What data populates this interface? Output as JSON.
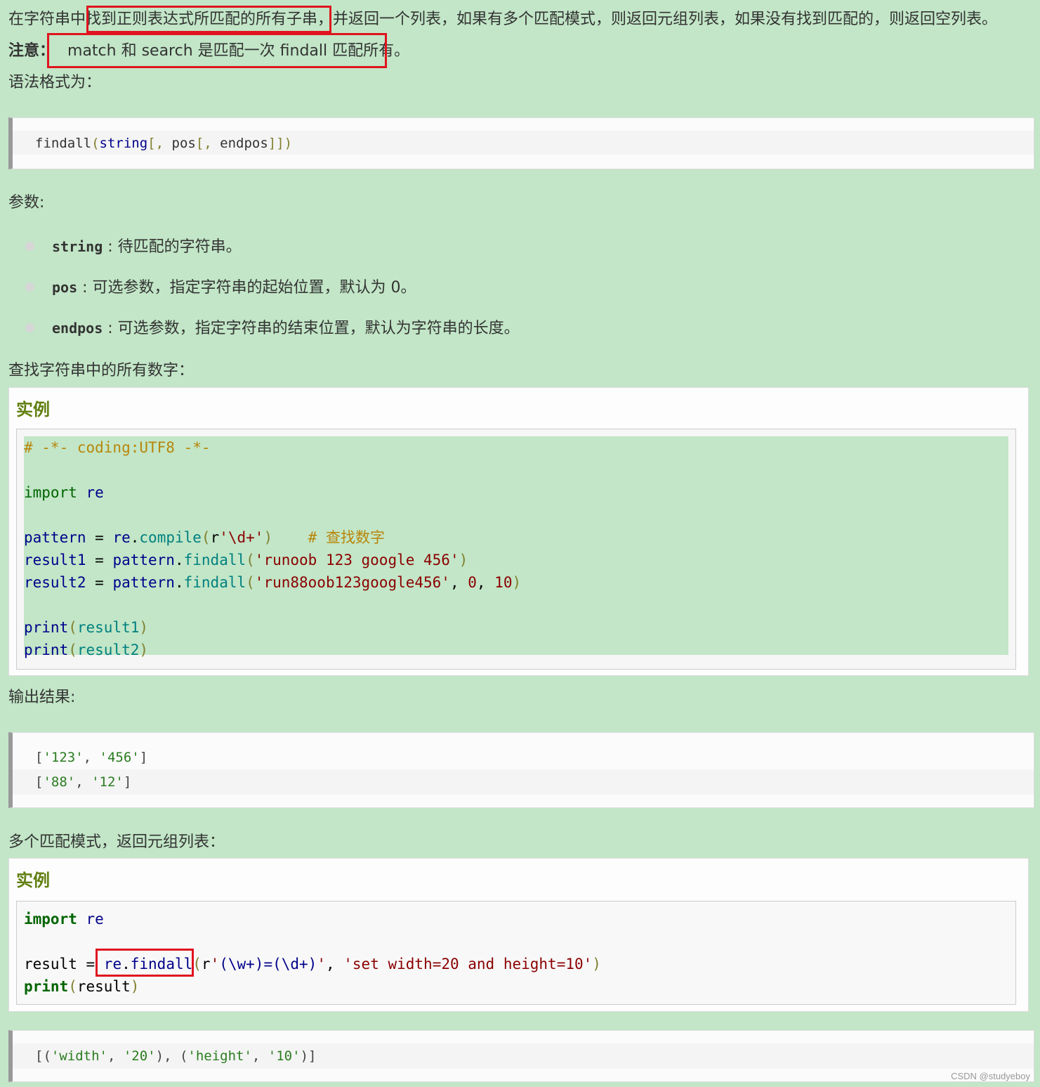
{
  "intro": {
    "line1_a": "在字符串中",
    "line1_highlight": "找到正则表达式所匹配的所有子串",
    "line1_b": "，并返回一个列表，如果有多个匹配模式，则返回元组列表，如果没有找到匹配的，则返回空列表。",
    "note_label": "注意：",
    "note_text": "match 和 search 是匹配一次 findall 匹配所有。",
    "syntax_label": "语法格式为："
  },
  "syntax": {
    "fn": "findall",
    "args_a": "(",
    "arg1": "string",
    "args_b": "[, ",
    "arg2": "pos",
    "args_c": "[, ",
    "arg3": "endpos",
    "args_d": "]])"
  },
  "params": {
    "label": "参数:",
    "items": [
      {
        "name": "string",
        "desc": " : 待匹配的字符串。"
      },
      {
        "name": "pos",
        "desc": " : 可选参数，指定字符串的起始位置，默认为 0。"
      },
      {
        "name": "endpos",
        "desc": " : 可选参数，指定字符串的结束位置，默认为字符串的长度。"
      }
    ]
  },
  "example1": {
    "intro": "查找字符串中的所有数字：",
    "title": "实例",
    "lines": {
      "l1": "# -*- coding:UTF8 -*-",
      "l3_kw": "import",
      "l3_mod": " re",
      "l5_var": "pattern",
      "l5_eq": " = ",
      "l5_mod": "re",
      "l5_dot": ".",
      "l5_fn": "compile",
      "l5_p1": "(",
      "l5_r": "r",
      "l5_str": "'\\d+'",
      "l5_p2": ")",
      "l5_cm": "    # 查找数字",
      "l6_var": "result1",
      "l6_eq": " = ",
      "l6_obj": "pattern",
      "l6_dot": ".",
      "l6_fn": "findall",
      "l6_p1": "(",
      "l6_str": "'runoob 123 google 456'",
      "l6_p2": ")",
      "l7_var": "result2",
      "l7_eq": " = ",
      "l7_obj": "pattern",
      "l7_dot": ".",
      "l7_fn": "findall",
      "l7_p1": "(",
      "l7_str": "'run88oob123google456'",
      "l7_c1": ", ",
      "l7_n1": "0",
      "l7_c2": ", ",
      "l7_n2": "10",
      "l7_p2": ")",
      "l9_fn": "print",
      "l9_p1": "(",
      "l9_arg": "result1",
      "l9_p2": ")",
      "l10_fn": "print",
      "l10_p1": "(",
      "l10_arg": "result2",
      "l10_p2": ")"
    },
    "output_label": "输出结果:",
    "output": {
      "o1_a": "[",
      "o1_s1": "'123'",
      "o1_b": ", ",
      "o1_s2": "'456'",
      "o1_c": "]",
      "o2_a": "[",
      "o2_s1": "'88'",
      "o2_b": ", ",
      "o2_s2": "'12'",
      "o2_c": "]"
    }
  },
  "example2": {
    "intro": "多个匹配模式，返回元组列表：",
    "title": "实例",
    "lines": {
      "l1_kw": "import",
      "l1_mod": " re",
      "l3_var": "result",
      "l3_eq": " = ",
      "l3_mod": "re",
      "l3_dot": ".",
      "l3_fn": "findall",
      "l3_p1": "(",
      "l3_r": "r",
      "l3_q1": "'",
      "l3_re": "(\\w+)=(\\d+)",
      "l3_q2": "'",
      "l3_c": ", ",
      "l3_str": "'set width=20 and height=10'",
      "l3_p2": ")",
      "l4_fn": "print",
      "l4_p1": "(",
      "l4_arg": "result",
      "l4_p2": ")"
    },
    "output": {
      "a": "[(",
      "s1": "'width'",
      "b": ", ",
      "s2": "'20'",
      "c": "), (",
      "s3": "'height'",
      "d": ", ",
      "s4": "'10'",
      "e": ")]"
    }
  },
  "watermark": "CSDN @studyeboy"
}
